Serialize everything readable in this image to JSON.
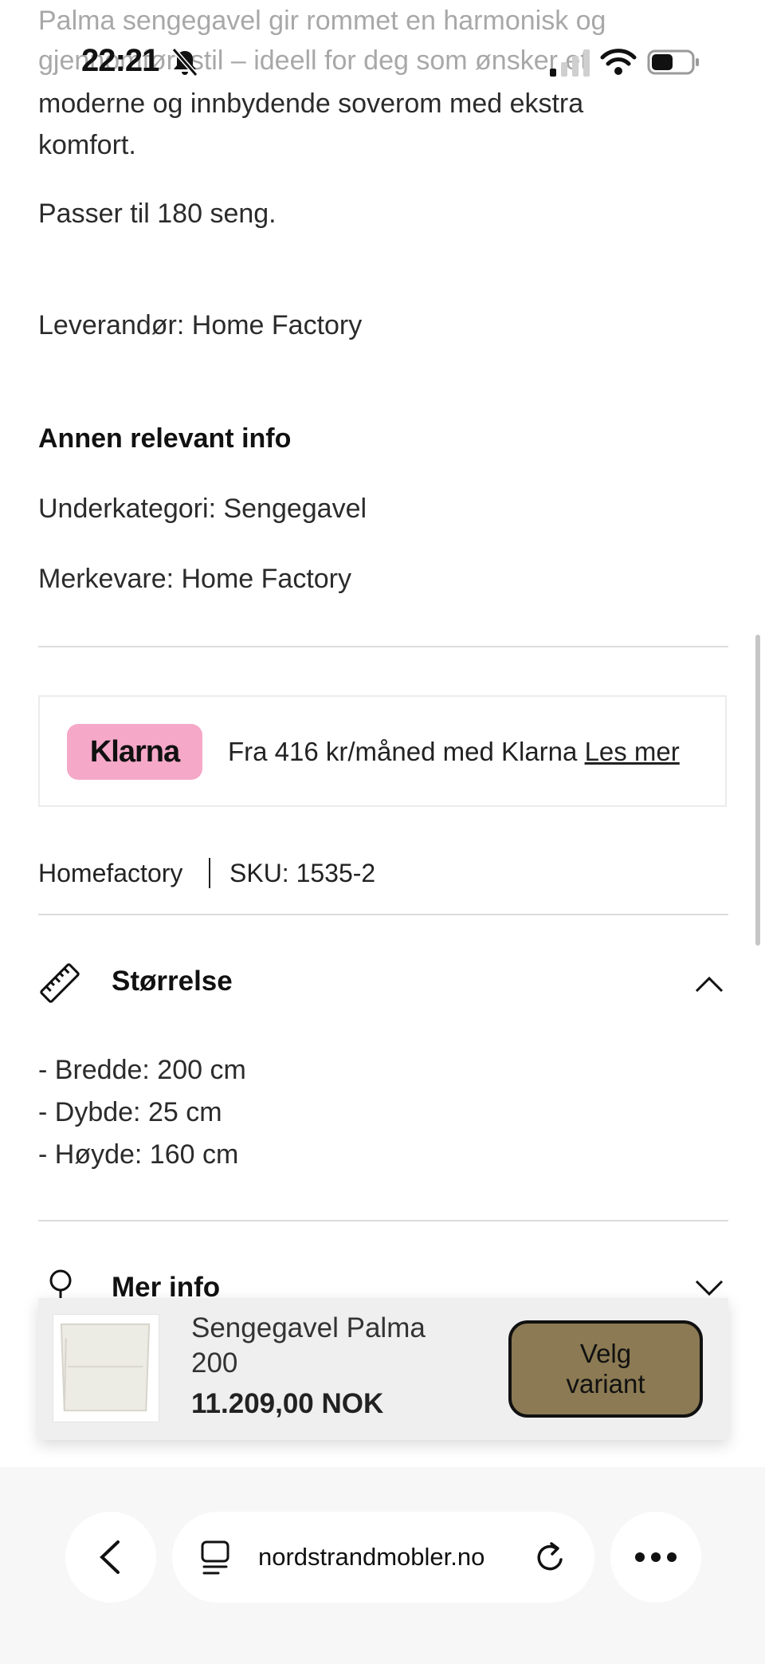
{
  "status_bar": {
    "time": "22:21"
  },
  "description": {
    "lines": [
      "Palma sengegavel gir rommet en harmonisk og",
      "gjennomført stil – ideell for deg som ønsker et",
      "moderne og innbydende soverom med ekstra",
      "komfort."
    ],
    "fits": "Passer til 180 seng.",
    "supplier": "Leverandør: Home Factory"
  },
  "other_info": {
    "heading": "Annen relevant info",
    "subcategory": "Underkategori: Sengegavel",
    "brand": "Merkevare: Home Factory"
  },
  "klarna": {
    "logo": "Klarna",
    "text": "Fra 416 kr/måned med Klarna",
    "link": "Les mer",
    "logo_color": "#f5a8c8"
  },
  "product_meta": {
    "vendor": "Homefactory",
    "sku": "SKU: 1535-2"
  },
  "sections": {
    "size": {
      "title": "Størrelse",
      "icon": "ruler-icon",
      "lines": [
        "- Bredde: 200 cm",
        "- Dybde: 25 cm",
        "- Høyde: 160 cm"
      ]
    },
    "more": {
      "title": "Mer info",
      "icon": "info-icon"
    }
  },
  "sticky_bar": {
    "name": "Sengegavel Palma 200",
    "price": "11.209,00 NOK",
    "button": "Velg variant",
    "button_color": "#8b7a53"
  },
  "browser": {
    "url": "nordstrandmobler.no"
  }
}
